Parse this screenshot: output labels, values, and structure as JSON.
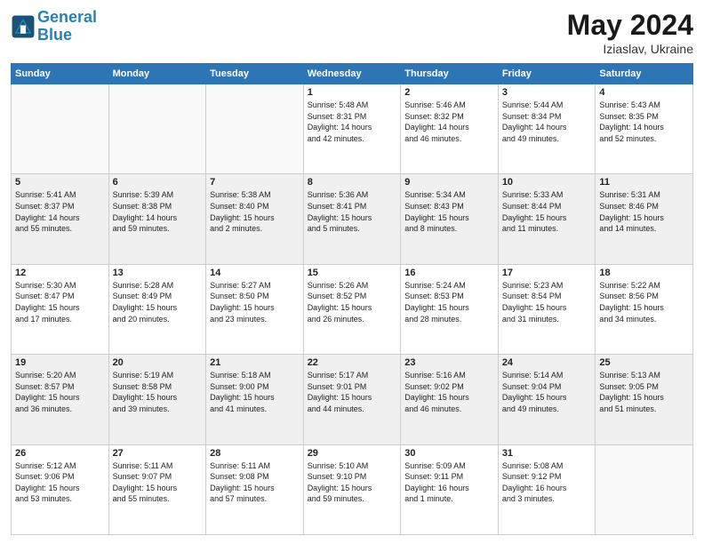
{
  "header": {
    "logo_line1": "General",
    "logo_line2": "Blue",
    "month": "May 2024",
    "location": "Iziaslav, Ukraine"
  },
  "weekdays": [
    "Sunday",
    "Monday",
    "Tuesday",
    "Wednesday",
    "Thursday",
    "Friday",
    "Saturday"
  ],
  "weeks": [
    [
      {
        "day": "",
        "info": ""
      },
      {
        "day": "",
        "info": ""
      },
      {
        "day": "",
        "info": ""
      },
      {
        "day": "1",
        "info": "Sunrise: 5:48 AM\nSunset: 8:31 PM\nDaylight: 14 hours\nand 42 minutes."
      },
      {
        "day": "2",
        "info": "Sunrise: 5:46 AM\nSunset: 8:32 PM\nDaylight: 14 hours\nand 46 minutes."
      },
      {
        "day": "3",
        "info": "Sunrise: 5:44 AM\nSunset: 8:34 PM\nDaylight: 14 hours\nand 49 minutes."
      },
      {
        "day": "4",
        "info": "Sunrise: 5:43 AM\nSunset: 8:35 PM\nDaylight: 14 hours\nand 52 minutes."
      }
    ],
    [
      {
        "day": "5",
        "info": "Sunrise: 5:41 AM\nSunset: 8:37 PM\nDaylight: 14 hours\nand 55 minutes."
      },
      {
        "day": "6",
        "info": "Sunrise: 5:39 AM\nSunset: 8:38 PM\nDaylight: 14 hours\nand 59 minutes."
      },
      {
        "day": "7",
        "info": "Sunrise: 5:38 AM\nSunset: 8:40 PM\nDaylight: 15 hours\nand 2 minutes."
      },
      {
        "day": "8",
        "info": "Sunrise: 5:36 AM\nSunset: 8:41 PM\nDaylight: 15 hours\nand 5 minutes."
      },
      {
        "day": "9",
        "info": "Sunrise: 5:34 AM\nSunset: 8:43 PM\nDaylight: 15 hours\nand 8 minutes."
      },
      {
        "day": "10",
        "info": "Sunrise: 5:33 AM\nSunset: 8:44 PM\nDaylight: 15 hours\nand 11 minutes."
      },
      {
        "day": "11",
        "info": "Sunrise: 5:31 AM\nSunset: 8:46 PM\nDaylight: 15 hours\nand 14 minutes."
      }
    ],
    [
      {
        "day": "12",
        "info": "Sunrise: 5:30 AM\nSunset: 8:47 PM\nDaylight: 15 hours\nand 17 minutes."
      },
      {
        "day": "13",
        "info": "Sunrise: 5:28 AM\nSunset: 8:49 PM\nDaylight: 15 hours\nand 20 minutes."
      },
      {
        "day": "14",
        "info": "Sunrise: 5:27 AM\nSunset: 8:50 PM\nDaylight: 15 hours\nand 23 minutes."
      },
      {
        "day": "15",
        "info": "Sunrise: 5:26 AM\nSunset: 8:52 PM\nDaylight: 15 hours\nand 26 minutes."
      },
      {
        "day": "16",
        "info": "Sunrise: 5:24 AM\nSunset: 8:53 PM\nDaylight: 15 hours\nand 28 minutes."
      },
      {
        "day": "17",
        "info": "Sunrise: 5:23 AM\nSunset: 8:54 PM\nDaylight: 15 hours\nand 31 minutes."
      },
      {
        "day": "18",
        "info": "Sunrise: 5:22 AM\nSunset: 8:56 PM\nDaylight: 15 hours\nand 34 minutes."
      }
    ],
    [
      {
        "day": "19",
        "info": "Sunrise: 5:20 AM\nSunset: 8:57 PM\nDaylight: 15 hours\nand 36 minutes."
      },
      {
        "day": "20",
        "info": "Sunrise: 5:19 AM\nSunset: 8:58 PM\nDaylight: 15 hours\nand 39 minutes."
      },
      {
        "day": "21",
        "info": "Sunrise: 5:18 AM\nSunset: 9:00 PM\nDaylight: 15 hours\nand 41 minutes."
      },
      {
        "day": "22",
        "info": "Sunrise: 5:17 AM\nSunset: 9:01 PM\nDaylight: 15 hours\nand 44 minutes."
      },
      {
        "day": "23",
        "info": "Sunrise: 5:16 AM\nSunset: 9:02 PM\nDaylight: 15 hours\nand 46 minutes."
      },
      {
        "day": "24",
        "info": "Sunrise: 5:14 AM\nSunset: 9:04 PM\nDaylight: 15 hours\nand 49 minutes."
      },
      {
        "day": "25",
        "info": "Sunrise: 5:13 AM\nSunset: 9:05 PM\nDaylight: 15 hours\nand 51 minutes."
      }
    ],
    [
      {
        "day": "26",
        "info": "Sunrise: 5:12 AM\nSunset: 9:06 PM\nDaylight: 15 hours\nand 53 minutes."
      },
      {
        "day": "27",
        "info": "Sunrise: 5:11 AM\nSunset: 9:07 PM\nDaylight: 15 hours\nand 55 minutes."
      },
      {
        "day": "28",
        "info": "Sunrise: 5:11 AM\nSunset: 9:08 PM\nDaylight: 15 hours\nand 57 minutes."
      },
      {
        "day": "29",
        "info": "Sunrise: 5:10 AM\nSunset: 9:10 PM\nDaylight: 15 hours\nand 59 minutes."
      },
      {
        "day": "30",
        "info": "Sunrise: 5:09 AM\nSunset: 9:11 PM\nDaylight: 16 hours\nand 1 minute."
      },
      {
        "day": "31",
        "info": "Sunrise: 5:08 AM\nSunset: 9:12 PM\nDaylight: 16 hours\nand 3 minutes."
      },
      {
        "day": "",
        "info": ""
      }
    ]
  ]
}
